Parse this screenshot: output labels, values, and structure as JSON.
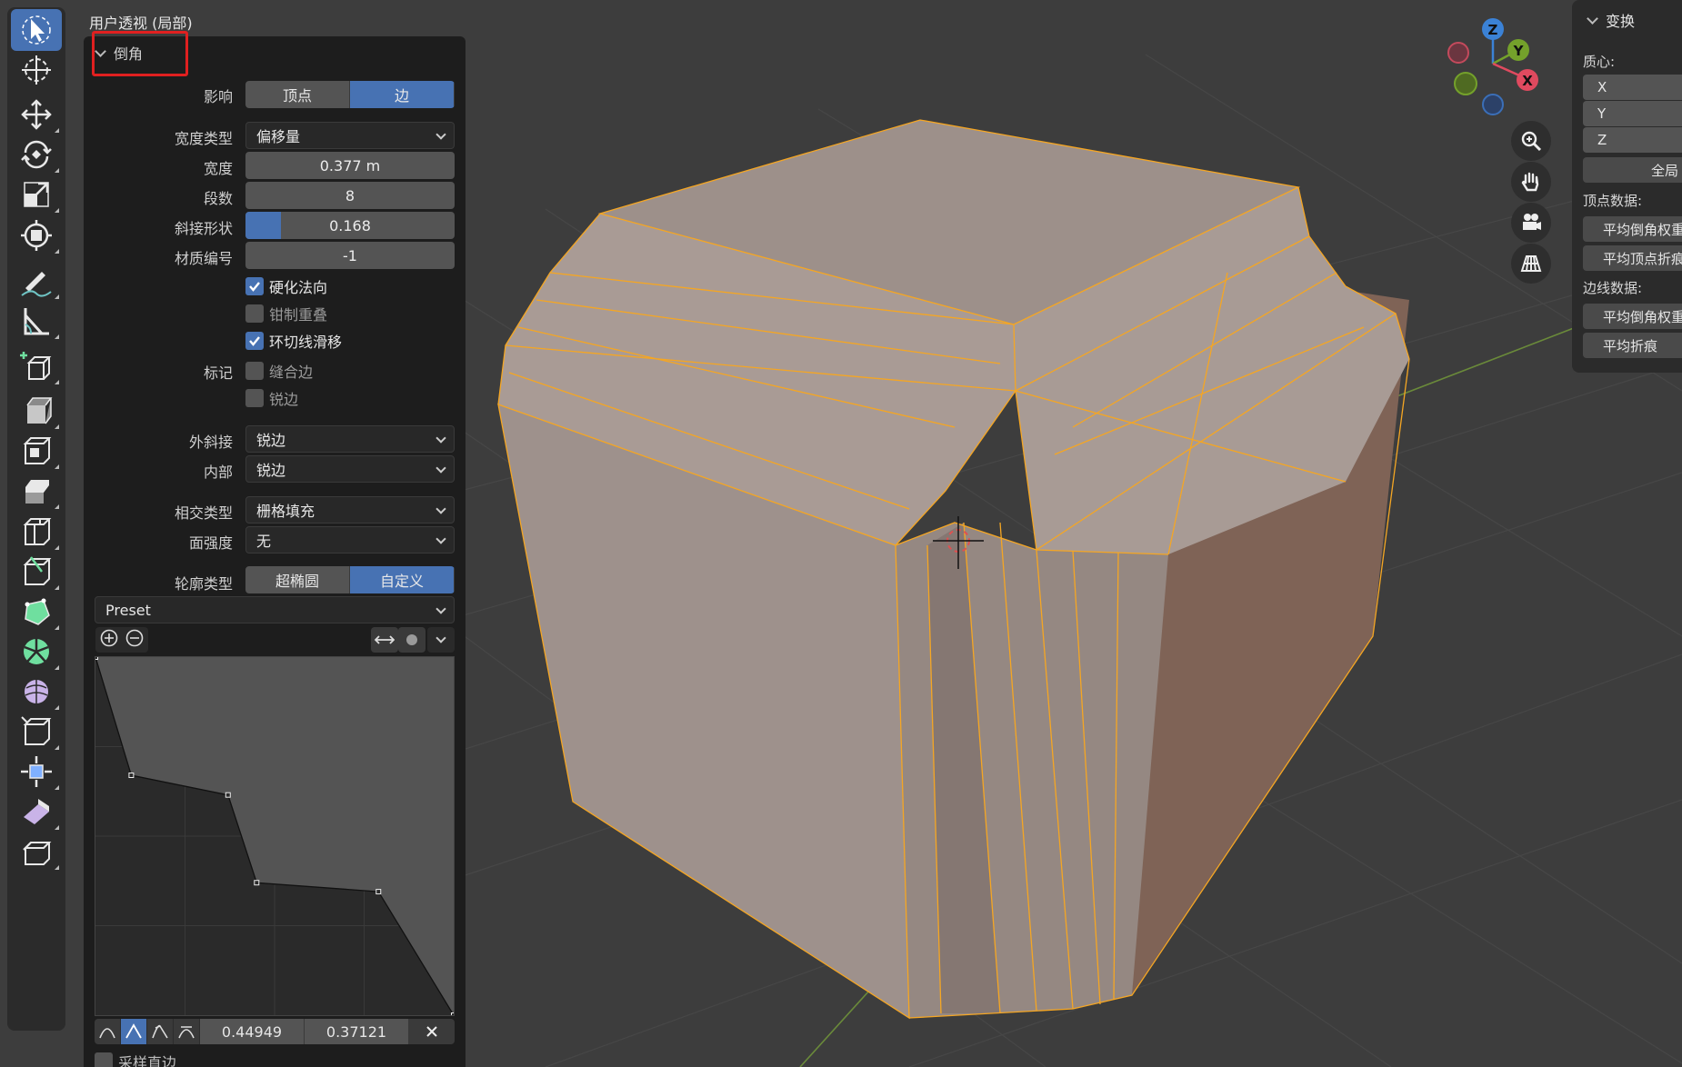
{
  "viewport": {
    "title": "用户透视 (局部)"
  },
  "toolbar": {
    "tools": [
      {
        "name": "select-tool",
        "icon": "select-arrow-icon",
        "active": true
      },
      {
        "name": "cursor-tool",
        "icon": "cursor-3d-icon",
        "active": false
      },
      {
        "name": "move-tool",
        "icon": "move-icon",
        "active": false
      },
      {
        "name": "rotate-tool",
        "icon": "rotate-icon",
        "active": false
      },
      {
        "name": "scale-tool",
        "icon": "scale-icon",
        "active": false
      },
      {
        "name": "transform-tool",
        "icon": "transform-icon",
        "active": false
      },
      {
        "name": "annotate-tool",
        "icon": "annotate-icon",
        "active": false
      },
      {
        "name": "measure-tool",
        "icon": "measure-icon",
        "active": false
      },
      {
        "name": "add-cube-tool",
        "icon": "add-cube-icon",
        "active": false
      },
      {
        "name": "extrude-tool",
        "icon": "extrude-icon",
        "active": false
      },
      {
        "name": "inset-tool",
        "icon": "inset-icon",
        "active": false
      },
      {
        "name": "bevel-tool",
        "icon": "bevel-icon",
        "active": false
      },
      {
        "name": "loop-cut-tool",
        "icon": "loop-cut-icon",
        "active": false
      },
      {
        "name": "knife-tool",
        "icon": "knife-icon",
        "active": false
      },
      {
        "name": "poly-build-tool",
        "icon": "poly-build-icon",
        "active": false
      },
      {
        "name": "spin-tool",
        "icon": "spin-icon",
        "active": false
      },
      {
        "name": "smooth-tool",
        "icon": "smooth-icon",
        "active": false
      },
      {
        "name": "edge-slide-tool",
        "icon": "edge-slide-icon",
        "active": false
      },
      {
        "name": "shrink-fatten-tool",
        "icon": "shrink-fatten-icon",
        "active": false
      },
      {
        "name": "shear-tool",
        "icon": "shear-icon",
        "active": false
      },
      {
        "name": "rip-tool",
        "icon": "rip-icon",
        "active": false
      }
    ]
  },
  "bevel": {
    "header": "倒角",
    "affect": {
      "label": "影响",
      "options": [
        "顶点",
        "边"
      ],
      "selected": "边"
    },
    "width_type": {
      "label": "宽度类型",
      "value": "偏移量"
    },
    "width": {
      "label": "宽度",
      "value": "0.377 m"
    },
    "segments": {
      "label": "段数",
      "value": "8"
    },
    "shape": {
      "label": "斜接形状",
      "value": "0.168",
      "fraction": 0.168
    },
    "material": {
      "label": "材质编号",
      "value": "-1"
    },
    "harden_normals": {
      "label": "硬化法向",
      "checked": true
    },
    "clamp_overlap": {
      "label": "钳制重叠",
      "checked": false
    },
    "loop_slide": {
      "label": "环切线滑移",
      "checked": true
    },
    "mark": {
      "label": "标记",
      "seam": {
        "label": "缝合边",
        "checked": false
      },
      "sharp": {
        "label": "锐边",
        "checked": false
      }
    },
    "miter_outer": {
      "label": "外斜接",
      "value": "锐边"
    },
    "miter_inner": {
      "label": "内部",
      "value": "锐边"
    },
    "intersection": {
      "label": "相交类型",
      "value": "栅格填充"
    },
    "face_strength": {
      "label": "面强度",
      "value": "无"
    },
    "profile_type": {
      "label": "轮廓类型",
      "options": [
        "超椭圆",
        "自定义"
      ],
      "selected": "自定义"
    },
    "preset": {
      "value": "Preset"
    },
    "curve": {
      "points": [
        [
          0.0,
          1.0
        ],
        [
          0.1,
          0.67
        ],
        [
          0.37,
          0.615
        ],
        [
          0.45,
          0.37
        ],
        [
          0.79,
          0.345
        ],
        [
          1.0,
          0.0
        ]
      ],
      "selected_point": {
        "x": "0.44949",
        "y": "0.37121"
      }
    },
    "sample_straight": {
      "label": "采样直边",
      "checked": false
    }
  },
  "navigation": {
    "gizmo": {
      "x_label": "X",
      "y_label": "Y",
      "z_label": "Z"
    },
    "buttons": [
      "zoom-icon",
      "hand-pan-icon",
      "camera-icon",
      "grid-perspective-icon"
    ]
  },
  "sidebar": {
    "header": "变换",
    "median_label": "质心:",
    "axes": [
      "X",
      "Y",
      "Z"
    ],
    "global_button": "全局",
    "vertex_data_label": "顶点数据:",
    "vertex_fields": [
      "平均倒角权重",
      "平均顶点折痕"
    ],
    "edge_data_label": "边线数据:",
    "edge_fields": [
      "平均倒角权重",
      "平均折痕"
    ]
  },
  "colors": {
    "accent": "#4772b3",
    "selection": "#f5a623",
    "highlight_box": "#e02020",
    "mesh": "#b3a49d"
  }
}
